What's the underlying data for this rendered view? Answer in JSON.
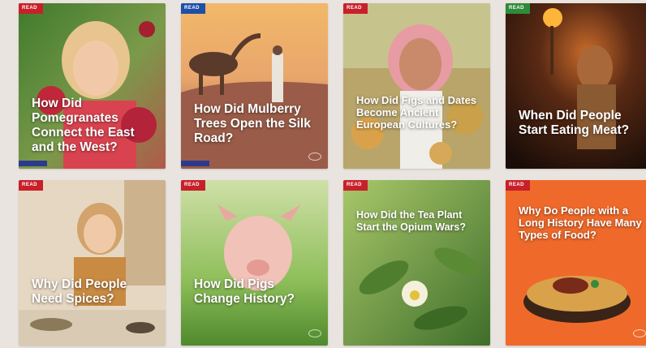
{
  "cards": [
    {
      "badge": "READ",
      "badge_color": "#c8202a",
      "title": "How Did Pomegranates Connect the East and the West?",
      "footer": "",
      "image": "girl-with-pomegranates"
    },
    {
      "badge": "READ",
      "badge_color": "#1d4fa8",
      "title": "How Did Mulberry Trees Open the Silk Road?",
      "footer": "",
      "image": "camel-in-desert"
    },
    {
      "badge": "READ",
      "badge_color": "#c8202a",
      "title": "How Did Figs and Dates Become Ancient European Cultures?",
      "footer": "",
      "image": "man-with-dates"
    },
    {
      "badge": "READ",
      "badge_color": "#2e8b3a",
      "title": "When Did People Start Eating Meat?",
      "footer": "",
      "image": "caveman-with-torch"
    },
    {
      "badge": "READ",
      "badge_color": "#c8202a",
      "title": "Why Did People Need Spices?",
      "footer": "",
      "image": "girl-with-spices"
    },
    {
      "badge": "READ",
      "badge_color": "#c8202a",
      "title": "How Did Pigs Change History?",
      "footer": "",
      "image": "piglet-on-grass"
    },
    {
      "badge": "READ",
      "badge_color": "#c8202a",
      "title": "How Did the Tea Plant Start the Opium Wars?",
      "footer": "",
      "image": "tea-plant-flower"
    },
    {
      "badge": "READ",
      "badge_color": "#c8202a",
      "title": "Why Do People with a Long History Have Many Types of Food?",
      "footer": "",
      "image": "bowl-of-food"
    }
  ]
}
